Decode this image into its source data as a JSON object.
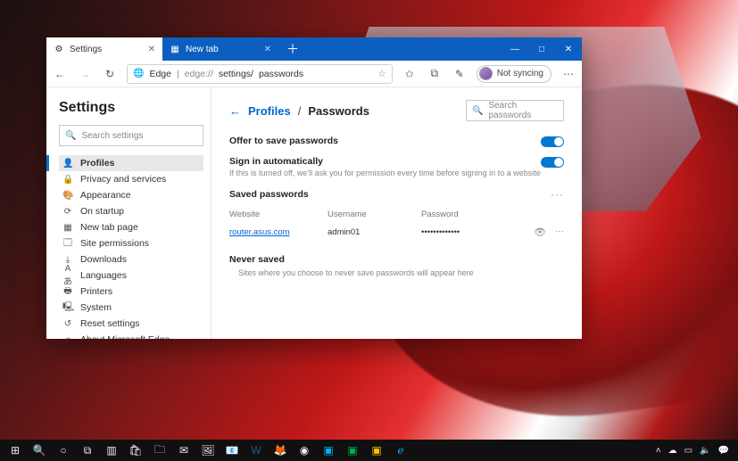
{
  "tabs": [
    {
      "label": "Settings",
      "icon": "⚙"
    },
    {
      "label": "New tab",
      "icon": "▦"
    }
  ],
  "window_controls": {
    "min": "—",
    "max": "□",
    "close": "✕"
  },
  "address": {
    "icon": "🌐",
    "host": "Edge",
    "sep": " | ",
    "dim": "edge://",
    "path": "settings/",
    "tail": "passwords"
  },
  "toolbar_icons": {
    "back": "←",
    "forward": "→",
    "refresh": "↻",
    "fav_star": "☆",
    "favorites": "✩",
    "collections": "⧉",
    "ink": "✎",
    "more": "⋯"
  },
  "profile_pill": "Not syncing",
  "sidebar": {
    "title": "Settings",
    "search_placeholder": "Search settings",
    "items": [
      {
        "icon": "👤",
        "label": "Profiles",
        "sel": true
      },
      {
        "icon": "🔒",
        "label": "Privacy and services"
      },
      {
        "icon": "🎨",
        "label": "Appearance"
      },
      {
        "icon": "⟳",
        "label": "On startup"
      },
      {
        "icon": "▦",
        "label": "New tab page"
      },
      {
        "icon": "🗔",
        "label": "Site permissions"
      },
      {
        "icon": "⤓",
        "label": "Downloads"
      },
      {
        "icon": "Aあ",
        "label": "Languages"
      },
      {
        "icon": "🖶",
        "label": "Printers"
      },
      {
        "icon": "🖳",
        "label": "System"
      },
      {
        "icon": "↺",
        "label": "Reset settings"
      },
      {
        "icon": "ℯ",
        "label": "About Microsoft Edge"
      }
    ]
  },
  "breadcrumb": {
    "back": "←",
    "parent": "Profiles",
    "sep": "/",
    "current": "Passwords"
  },
  "search_passwords_placeholder": "Search passwords",
  "options": [
    {
      "label": "Offer to save passwords",
      "on": true
    },
    {
      "label": "Sign in automatically",
      "desc": "If this is turned off, we'll ask you for permission every time before signing in to a website",
      "on": true
    }
  ],
  "saved_section": {
    "title": "Saved passwords",
    "more": "···"
  },
  "columns": {
    "site": "Website",
    "user": "Username",
    "pass": "Password"
  },
  "rows": [
    {
      "site": "router.asus.com",
      "user": "admin01",
      "pass": "•••••••••••••"
    }
  ],
  "row_icons": {
    "eye": "👁",
    "more": "···"
  },
  "never": {
    "title": "Never saved",
    "desc": "Sites where you choose to never save passwords will appear here"
  },
  "tray": {
    "up": "˄",
    "cloud": "☁",
    "net": "▭",
    "vol": "🔈",
    "msg": "💬"
  }
}
